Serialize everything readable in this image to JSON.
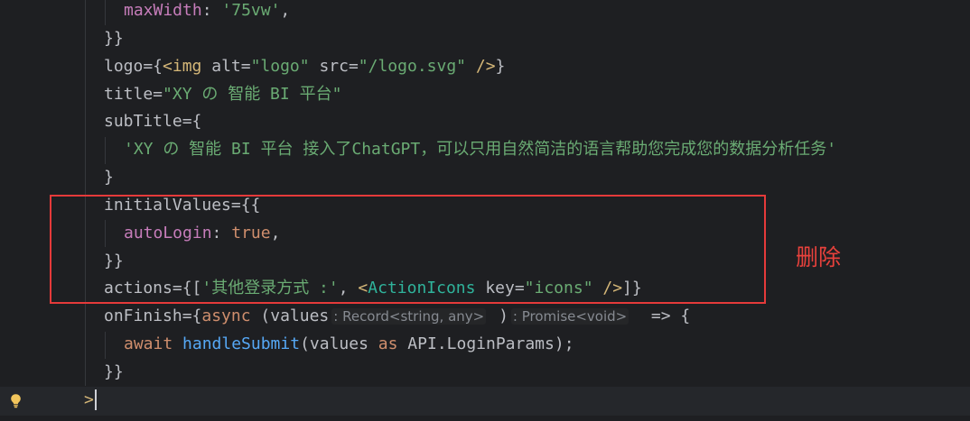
{
  "theme": {
    "background": "#1e1f22",
    "text": "#bcbec4",
    "property": "#c77dbb",
    "string": "#6aab73",
    "keyword": "#cf8e6d",
    "tag": "#d5b778",
    "component": "#2fb39b",
    "function": "#56a8f5",
    "hint": "#868a91"
  },
  "gutter": {
    "icon": "lightbulb-icon"
  },
  "code": {
    "lines": [
      [
        "maxWidth",
        ": ",
        "'75vw'",
        ","
      ],
      [
        "}}"
      ],
      [
        "logo={",
        "<img",
        " alt=",
        "\"logo\"",
        " src=",
        "\"/logo.svg\"",
        " />",
        "}"
      ],
      [
        "title=",
        "\"XY の 智能 BI 平台\""
      ],
      [
        "subTitle={"
      ],
      [
        "'XY の 智能 BI 平台 接入了ChatGPT，可以只用自然简洁的语言帮助您完成您的数据分析任务'"
      ],
      [
        "}"
      ],
      [
        "initialValues={{"
      ],
      [
        "autoLogin",
        ": ",
        "true",
        ","
      ],
      [
        "}}"
      ],
      [
        "actions={[",
        "'其他登录方式 :'",
        ", ",
        "<",
        "ActionIcons",
        " key=",
        "\"icons\"",
        " />",
        "]}"
      ],
      [
        "onFinish={",
        "async",
        " (values",
        ": Record<string, any>",
        " )",
        ": Promise<void>",
        "  => {"
      ],
      [
        "await",
        " handleSubmit",
        "(values ",
        "as",
        " API.LoginParams);"
      ],
      [
        "}}"
      ],
      [
        ">"
      ]
    ]
  },
  "annotation": {
    "label": "删除",
    "color": "#e53a3a"
  }
}
